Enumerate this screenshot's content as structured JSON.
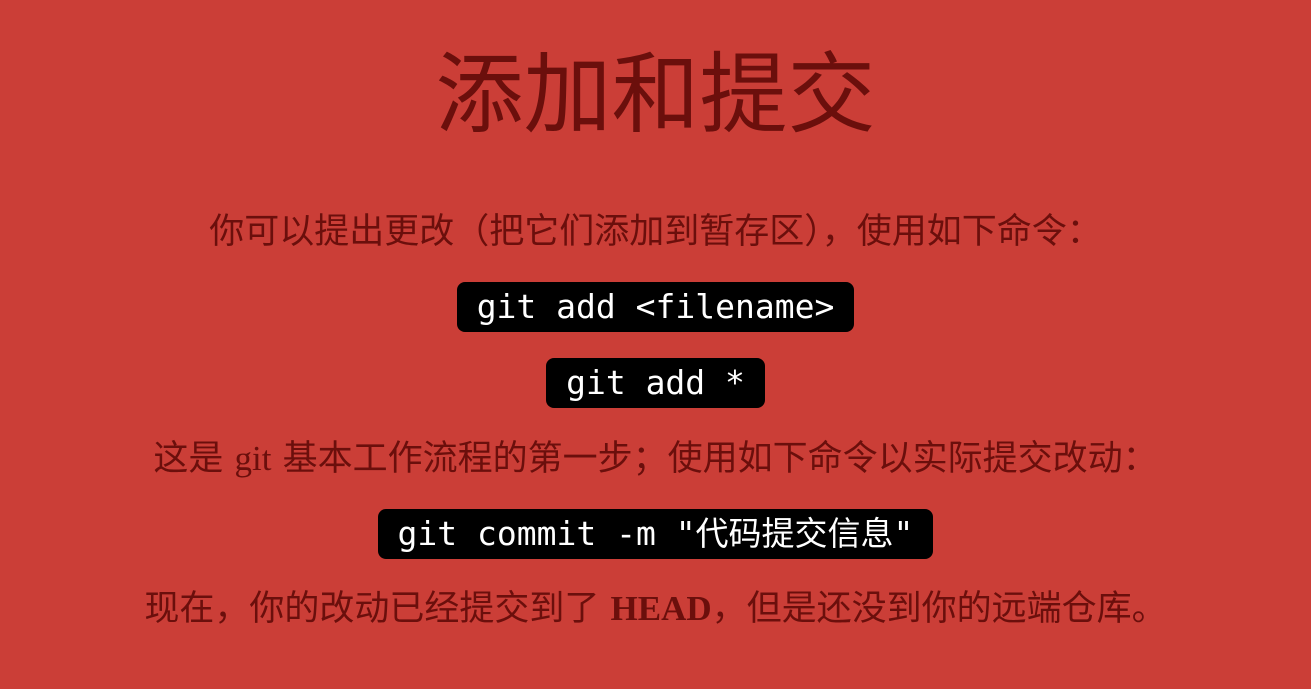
{
  "slide": {
    "title": "添加和提交",
    "para1": "你可以提出更改（把它们添加到暂存区），使用如下命令：",
    "code1": "git add <filename>",
    "code2": "git add *",
    "para2": {
      "before": "这是 ",
      "git": "git",
      "after": " 基本工作流程的第一步；使用如下命令以实际提交改动："
    },
    "code3": "git commit -m \"代码提交信息\"",
    "para3": {
      "before": "现在，你的改动已经提交到了 ",
      "head": "HEAD",
      "after": "，但是还没到你的远端仓库。"
    }
  },
  "colors": {
    "background": "#cb3e37",
    "text": "#6b0f0c",
    "code_background": "#000000",
    "code_text": "#ffffff"
  }
}
